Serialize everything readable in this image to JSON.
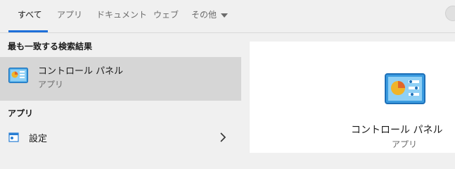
{
  "tabs": [
    {
      "label": "すべて",
      "active": true
    },
    {
      "label": "アプリ"
    },
    {
      "label": "ドキュメント"
    },
    {
      "label": "ウェブ"
    },
    {
      "label": "その他"
    }
  ],
  "best_match": {
    "section_title": "最も一致する検索結果",
    "name": "コントロール パネル",
    "type": "アプリ"
  },
  "apps": {
    "section_title": "アプリ",
    "items": [
      {
        "name": "設定"
      }
    ]
  },
  "preview": {
    "name": "コントロール パネル",
    "type": "アプリ"
  },
  "colors": {
    "accent": "#1e6fd9",
    "selected_bg": "#d6d6d6",
    "panel_bg": "#f0f0f0"
  },
  "icons": {
    "best_match": "control-panel-icon",
    "settings": "settings-icon",
    "more_dropdown": "chevron-down-icon",
    "open_item": "chevron-right-icon"
  }
}
